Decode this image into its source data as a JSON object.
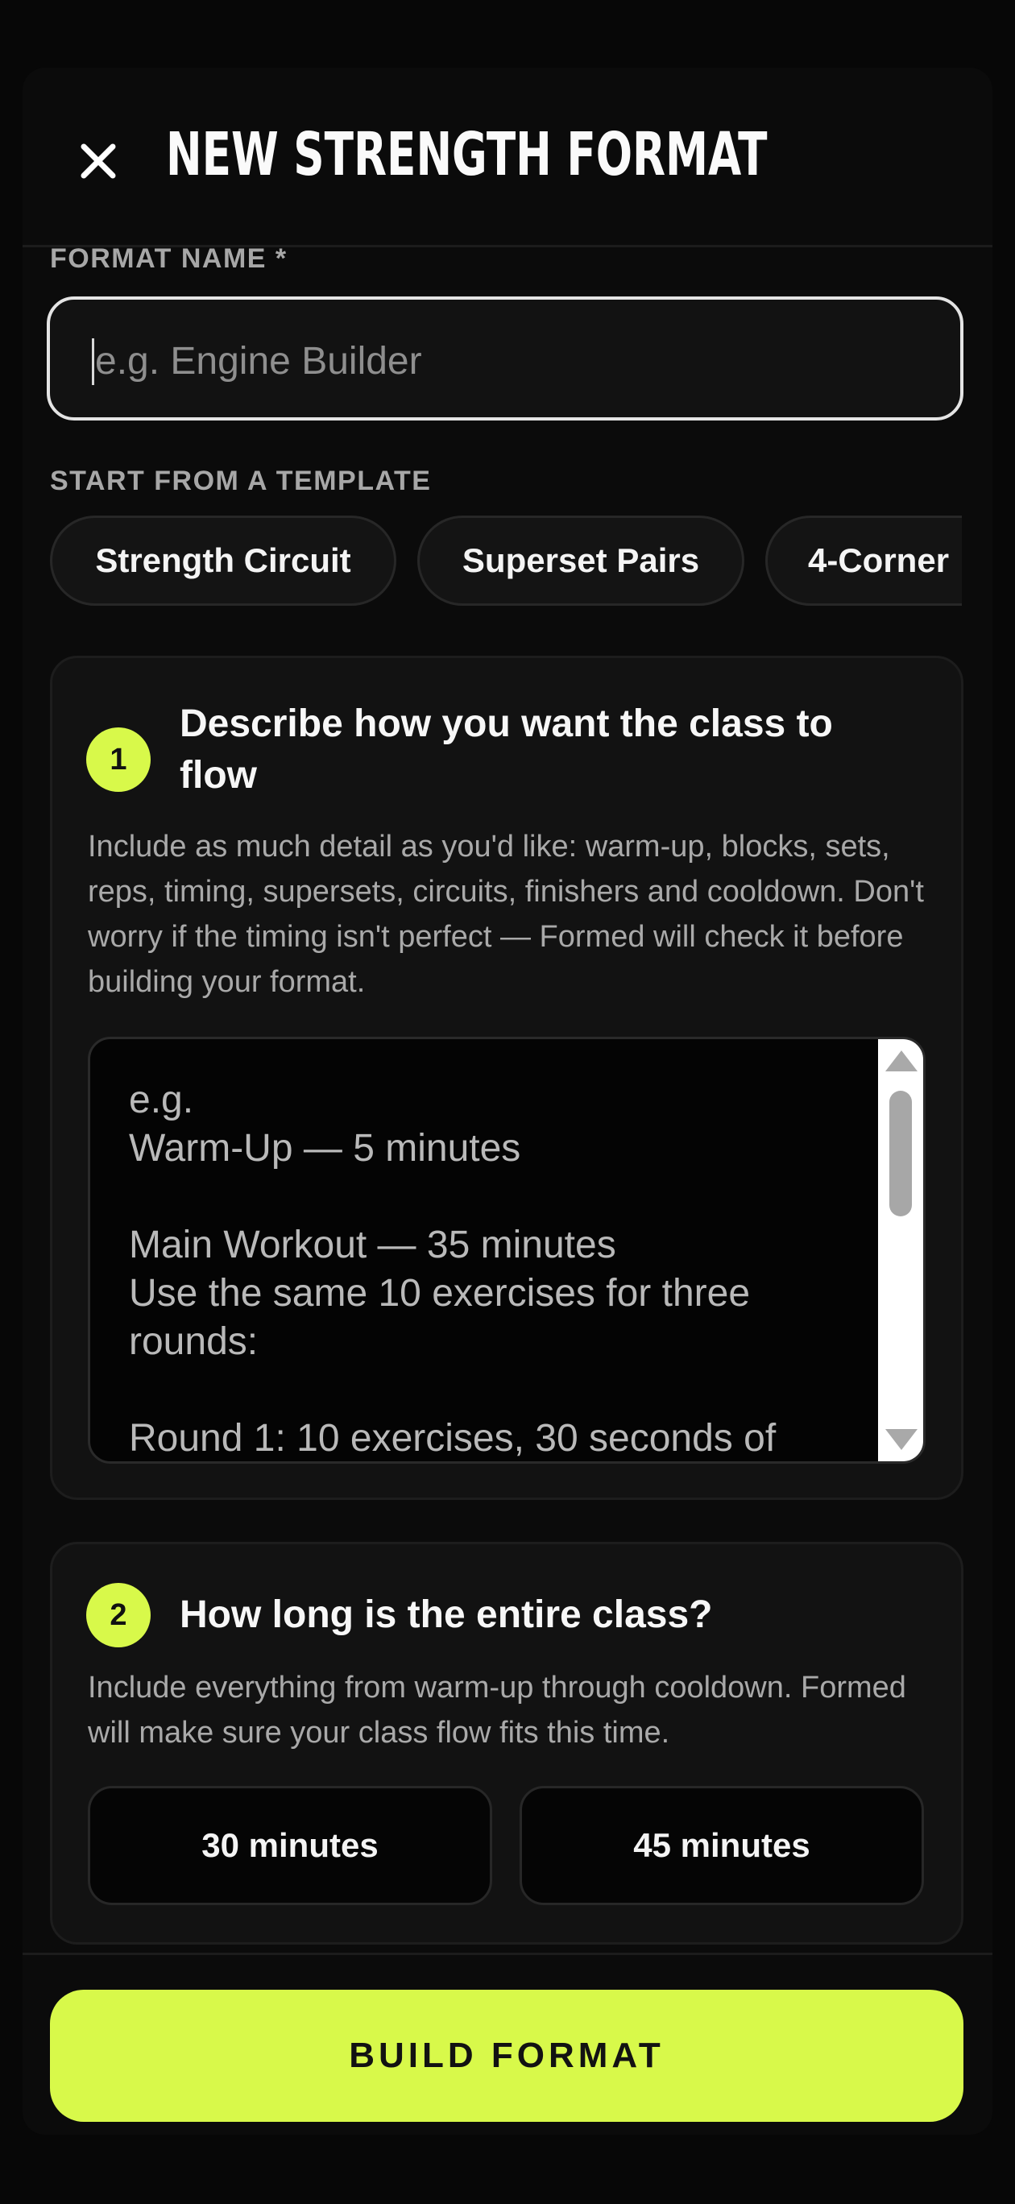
{
  "header": {
    "title": "NEW STRENGTH FORMAT",
    "close_icon": "close-icon"
  },
  "format_name": {
    "label": "FORMAT NAME *",
    "value": "",
    "placeholder": "e.g. Engine Builder"
  },
  "templates": {
    "label": "START FROM A TEMPLATE",
    "chips": [
      "Strength Circuit",
      "Superset Pairs",
      "4-Corner"
    ]
  },
  "step1": {
    "number": "1",
    "title": "Describe how you want the class to flow",
    "description": "Include as much detail as you'd like: warm-up, blocks, sets, reps, timing, supersets, circuits, finishers and cooldown. Don't worry if the timing isn't perfect — Formed will check it before building your format.",
    "placeholder": "e.g.\nWarm-Up — 5 minutes\n\nMain Workout — 35 minutes\nUse the same 10 exercises for three rounds:\n\nRound 1: 10 exercises, 30 seconds of"
  },
  "step2": {
    "number": "2",
    "title": "How long is the entire class?",
    "description": "Include everything from warm-up through cooldown. Formed will make sure your class flow fits this time.",
    "options": [
      "30 minutes",
      "45 minutes"
    ]
  },
  "footer": {
    "build_label": "BUILD FORMAT"
  },
  "colors": {
    "accent": "#d8f94a",
    "background": "#0b0b0b",
    "card": "#121212"
  }
}
